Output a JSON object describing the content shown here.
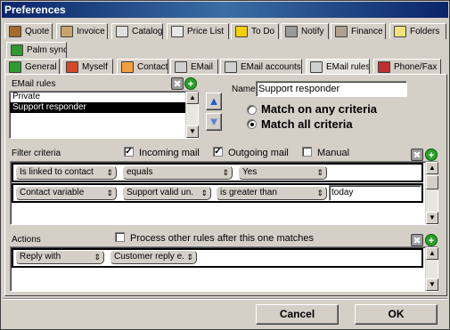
{
  "window": {
    "title": "Preferences"
  },
  "tabs_row1": [
    {
      "label": "Quote",
      "icon": "quote-icon",
      "color": "#a66a2d"
    },
    {
      "label": "Invoice",
      "icon": "invoice-icon",
      "color": "#c9a56b"
    },
    {
      "label": "Catalog",
      "icon": "catalog-icon",
      "color": "#e0e0e0"
    },
    {
      "label": "Price List",
      "icon": "price-list-icon",
      "color": "#e8e8e8"
    },
    {
      "label": "To Do",
      "icon": "todo-icon",
      "color": "#f5d000"
    },
    {
      "label": "Notify",
      "icon": "notify-icon",
      "color": "#9a9a9a"
    },
    {
      "label": "Finance",
      "icon": "finance-icon",
      "color": "#b0a090"
    },
    {
      "label": "Folders",
      "icon": "folder-icon",
      "color": "#f3e27a"
    }
  ],
  "tabs_row2": [
    {
      "label": "Palm sync",
      "icon": "palm-icon",
      "color": "#2f9a2f"
    }
  ],
  "tabs_row3": [
    {
      "label": "General",
      "icon": "general-icon",
      "color": "#2f9a2f"
    },
    {
      "label": "Myself",
      "icon": "myself-icon",
      "color": "#d24a2a"
    },
    {
      "label": "Contact",
      "icon": "contact-icon",
      "color": "#f0a040"
    },
    {
      "label": "EMail",
      "icon": "email-icon",
      "color": "#d0d0d0"
    },
    {
      "label": "EMail accounts",
      "icon": "email-accounts-icon",
      "color": "#d0d0d0"
    },
    {
      "label": "EMail rules",
      "icon": "email-rules-icon",
      "color": "#d0d0d0",
      "active": true
    },
    {
      "label": "Phone/Fax",
      "icon": "phone-icon",
      "color": "#c03030"
    }
  ],
  "email_rules": {
    "label": "EMail rules",
    "items": [
      "Private",
      "Support responder"
    ],
    "selected_index": 1
  },
  "name_field": {
    "label": "Name",
    "value": "Support responder"
  },
  "match": {
    "any_label": "Match on any criteria",
    "all_label": "Match all criteria",
    "selected": "all"
  },
  "filter": {
    "label": "Filter criteria",
    "incoming_label": "Incoming mail",
    "incoming_checked": true,
    "outgoing_label": "Outgoing mail",
    "outgoing_checked": true,
    "manual_label": "Manual",
    "manual_checked": false,
    "rows": [
      {
        "field": "Is linked to contact",
        "operator": "equals",
        "value": "Yes"
      },
      {
        "field": "Contact variable",
        "subfield": "Support valid un.",
        "operator": "is greater than",
        "value": "today"
      }
    ]
  },
  "actions": {
    "label": "Actions",
    "process_label": "Process other rules after this one matches",
    "process_checked": false,
    "rows": [
      {
        "action": "Reply with",
        "value": "Customer reply e."
      }
    ]
  },
  "buttons": {
    "cancel": "Cancel",
    "ok": "OK"
  }
}
